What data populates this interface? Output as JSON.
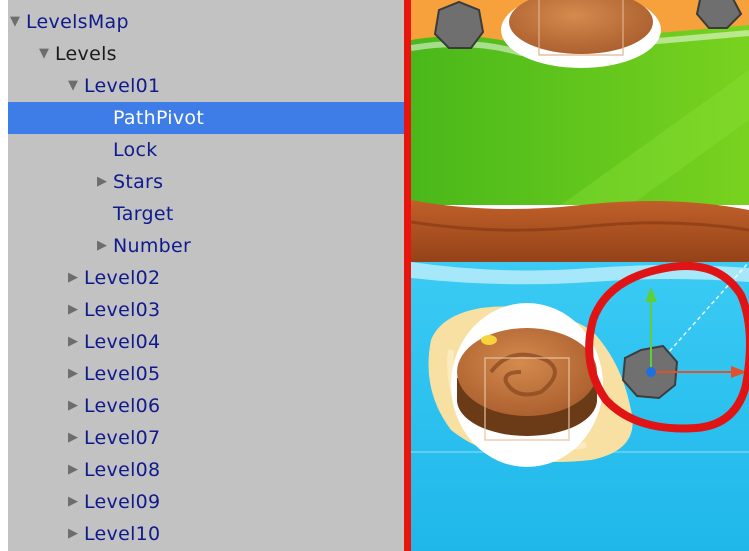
{
  "hierarchy": {
    "items": [
      {
        "label": "LevelsMap",
        "depth": 0,
        "arrow": "expanded",
        "selected": false,
        "style": "prefab"
      },
      {
        "label": "Levels",
        "depth": 1,
        "arrow": "expanded",
        "selected": false,
        "style": "plain"
      },
      {
        "label": "Level01",
        "depth": 2,
        "arrow": "expanded",
        "selected": false,
        "style": "prefab"
      },
      {
        "label": "PathPivot",
        "depth": 3,
        "arrow": "none",
        "selected": true,
        "style": "prefab"
      },
      {
        "label": "Lock",
        "depth": 3,
        "arrow": "none",
        "selected": false,
        "style": "prefab"
      },
      {
        "label": "Stars",
        "depth": 3,
        "arrow": "collapsed",
        "selected": false,
        "style": "prefab"
      },
      {
        "label": "Target",
        "depth": 3,
        "arrow": "none",
        "selected": false,
        "style": "prefab"
      },
      {
        "label": "Number",
        "depth": 3,
        "arrow": "collapsed",
        "selected": false,
        "style": "prefab"
      },
      {
        "label": "Level02",
        "depth": 2,
        "arrow": "collapsed",
        "selected": false,
        "style": "prefab"
      },
      {
        "label": "Level03",
        "depth": 2,
        "arrow": "collapsed",
        "selected": false,
        "style": "prefab"
      },
      {
        "label": "Level04",
        "depth": 2,
        "arrow": "collapsed",
        "selected": false,
        "style": "prefab"
      },
      {
        "label": "Level05",
        "depth": 2,
        "arrow": "collapsed",
        "selected": false,
        "style": "prefab"
      },
      {
        "label": "Level06",
        "depth": 2,
        "arrow": "collapsed",
        "selected": false,
        "style": "prefab"
      },
      {
        "label": "Level07",
        "depth": 2,
        "arrow": "collapsed",
        "selected": false,
        "style": "prefab"
      },
      {
        "label": "Level08",
        "depth": 2,
        "arrow": "collapsed",
        "selected": false,
        "style": "prefab"
      },
      {
        "label": "Level09",
        "depth": 2,
        "arrow": "collapsed",
        "selected": false,
        "style": "prefab"
      },
      {
        "label": "Level10",
        "depth": 2,
        "arrow": "collapsed",
        "selected": false,
        "style": "prefab"
      }
    ]
  },
  "colors": {
    "panel_bg": "#c2c2c2",
    "selection": "#3e7de7",
    "prefab_text": "#0f1a8c",
    "divider": "#e8140e",
    "water": "#29c3ef",
    "grass": "#5fc41d",
    "highlight_circle": "#e01414"
  },
  "icons": {
    "expanded": "triangle-down-icon",
    "collapsed": "triangle-right-icon"
  }
}
